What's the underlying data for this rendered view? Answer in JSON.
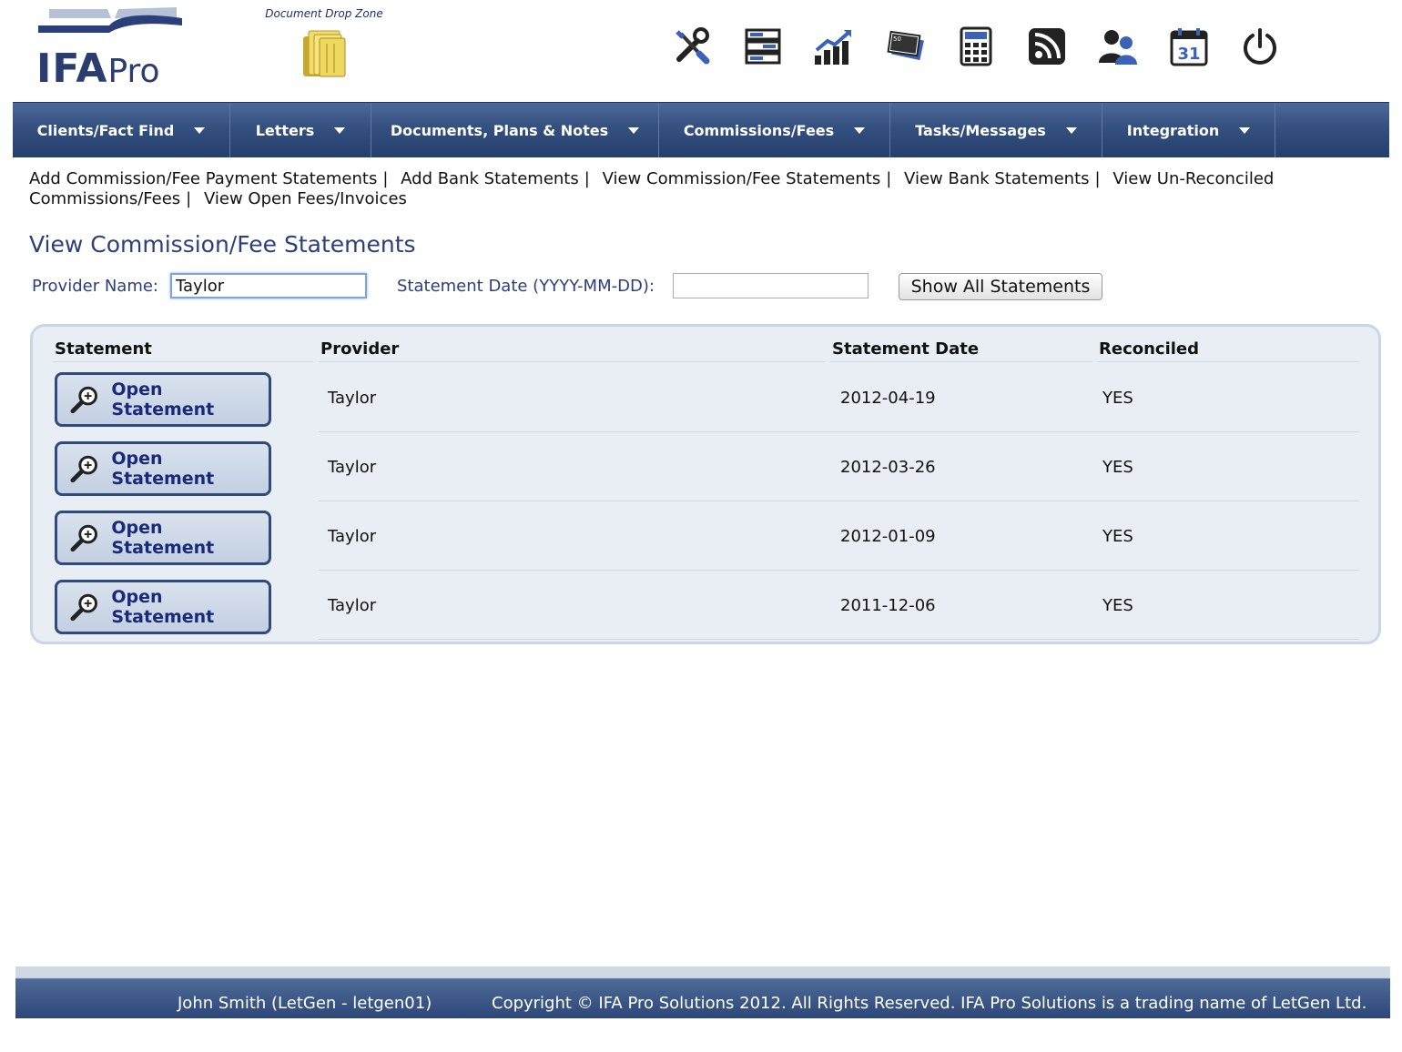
{
  "header": {
    "logo_text": "IFA",
    "logo_suffix": "Pro",
    "dropzone_label": "Document Drop Zone",
    "icons": [
      "tools-icon",
      "filing-cabinet-icon",
      "chart-growth-icon",
      "banknotes-icon",
      "calculator-icon",
      "rss-feed-icon",
      "contacts-icon",
      "calendar-icon",
      "power-icon"
    ],
    "calendar_day": "31"
  },
  "nav": {
    "items": [
      {
        "label": "Clients/Fact Find"
      },
      {
        "label": "Letters"
      },
      {
        "label": "Documents, Plans & Notes"
      },
      {
        "label": "Commissions/Fees"
      },
      {
        "label": "Tasks/Messages"
      },
      {
        "label": "Integration"
      }
    ]
  },
  "sublinks": [
    "Add Commission/Fee Payment Statements",
    "Add Bank Statements",
    "View Commission/Fee Statements",
    "View Bank Statements",
    "View Un-Reconciled Commissions/Fees",
    "View Open Fees/Invoices"
  ],
  "separator": "|",
  "page_title": "View Commission/Fee Statements",
  "filters": {
    "provider_label": "Provider Name:",
    "provider_value": "Taylor",
    "date_label": "Statement Date (YYYY-MM-DD):",
    "date_value": "",
    "show_all_label": "Show All Statements"
  },
  "table": {
    "headers": {
      "statement": "Statement",
      "provider": "Provider",
      "date": "Statement Date",
      "reconciled": "Reconciled"
    },
    "open_label": "Open Statement",
    "rows": [
      {
        "provider": "Taylor",
        "date": "2012-04-19",
        "reconciled": "YES"
      },
      {
        "provider": "Taylor",
        "date": "2012-03-26",
        "reconciled": "YES"
      },
      {
        "provider": "Taylor",
        "date": "2012-01-09",
        "reconciled": "YES"
      },
      {
        "provider": "Taylor",
        "date": "2011-12-06",
        "reconciled": "YES"
      }
    ]
  },
  "footer": {
    "user": "John Smith (LetGen - letgen01)",
    "copyright": "Copyright © IFA Pro Solutions 2012. All Rights Reserved. IFA Pro Solutions is a trading name of LetGen Ltd."
  },
  "colors": {
    "nav": "#34507f",
    "title": "#2b3f7a",
    "panel": "#e8eef4",
    "button_text": "#1a2a7a"
  }
}
